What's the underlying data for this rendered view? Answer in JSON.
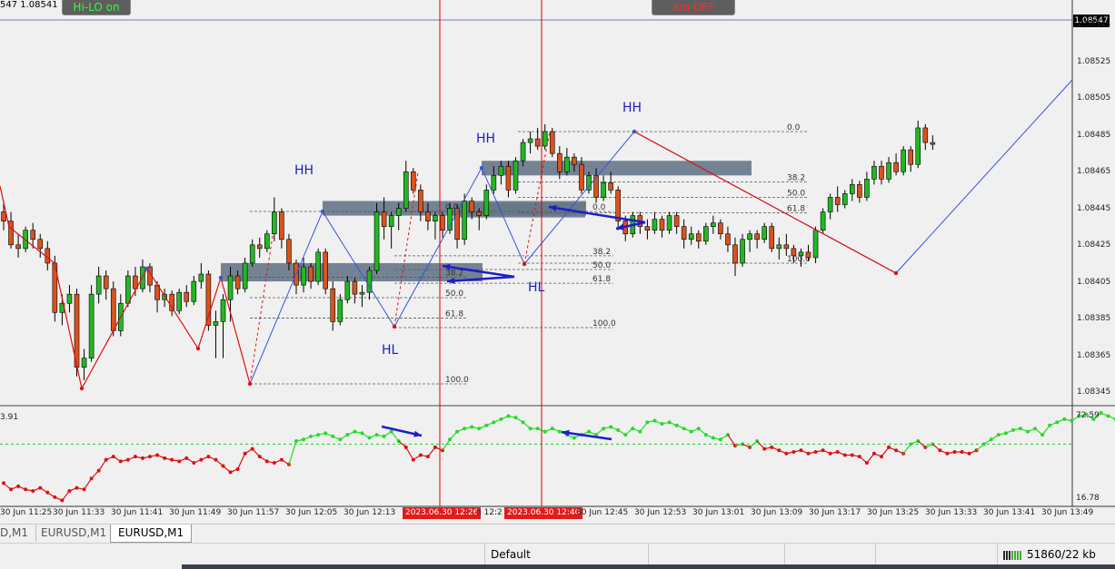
{
  "window": {
    "ohlc_text": "547 1.08541 1.08",
    "current_price": "1.08547",
    "buttons": {
      "hilo": "Hi-LO on",
      "am": "am OFF"
    }
  },
  "price_axis": [
    "1.08545",
    "1.08525",
    "1.08505",
    "1.08485",
    "1.08465",
    "1.08445",
    "1.08425",
    "1.08405",
    "1.08385",
    "1.08365",
    "1.08345"
  ],
  "indicator_axis": {
    "top": "72.59",
    "bottom": "16.78",
    "left_value": "3.91"
  },
  "time_axis": [
    "30 Jun 11:25",
    "30 Jun 11:33",
    "30 Jun 11:41",
    "30 Jun 11:49",
    "30 Jun 11:57",
    "30 Jun 12:05",
    "30 Jun 12:13",
    "2023.06.30 12:26",
    "n 12:2",
    "2023.06.30 12:40",
    "30 Jun 12:45",
    "30 Jun 12:53",
    "30 Jun 13:01",
    "30 Jun 13:09",
    "30 Jun 13:17",
    "30 Jun 13:25",
    "30 Jun 13:33",
    "30 Jun 13:41",
    "30 Jun 13:49"
  ],
  "annotations": {
    "hh1": "HH",
    "hh2": "HH",
    "hh3": "HH",
    "hl1": "HL",
    "hl2": "HL"
  },
  "fibo": [
    "0.0",
    "38.2",
    "50.0",
    "61.8",
    "100.0"
  ],
  "tabs": [
    "D,M1",
    "EURUSD,M1",
    "EURUSD,M1"
  ],
  "status": {
    "profile": "Default",
    "traffic": "51860/22 kb"
  },
  "colors": {
    "bull": "#22b822",
    "bear": "#d9531e",
    "zigzag": "#dd1111",
    "trend": "#3355dd",
    "zone": "#667788",
    "ind_up": "#22dd22",
    "ind_down": "#dd1111",
    "vline": "#dd0000"
  },
  "chart_data": {
    "type": "candlestick",
    "symbol": "EURUSD",
    "timeframe": "M1",
    "ylim": [
      1.08335,
      1.08555
    ],
    "candles": [
      [
        1.0844,
        1.08446,
        1.0843,
        1.08435
      ],
      [
        1.08435,
        1.0844,
        1.0842,
        1.08422
      ],
      [
        1.08422,
        1.08428,
        1.08415,
        1.0842
      ],
      [
        1.0842,
        1.08432,
        1.08418,
        1.0843
      ],
      [
        1.0843,
        1.08434,
        1.0842,
        1.08425
      ],
      [
        1.08425,
        1.08428,
        1.08415,
        1.0842
      ],
      [
        1.0842,
        1.08424,
        1.08408,
        1.08412
      ],
      [
        1.08412,
        1.08416,
        1.0838,
        1.08385
      ],
      [
        1.08385,
        1.08395,
        1.08378,
        1.0839
      ],
      [
        1.0839,
        1.084,
        1.08385,
        1.08395
      ],
      [
        1.08395,
        1.08398,
        1.0835,
        1.08355
      ],
      [
        1.08355,
        1.08365,
        1.08348,
        1.0836
      ],
      [
        1.0836,
        1.084,
        1.08358,
        1.08395
      ],
      [
        1.08395,
        1.0841,
        1.0839,
        1.08405
      ],
      [
        1.08405,
        1.08408,
        1.08392,
        1.08398
      ],
      [
        1.08398,
        1.08402,
        1.08372,
        1.08375
      ],
      [
        1.08375,
        1.08395,
        1.08372,
        1.0839
      ],
      [
        1.0839,
        1.08408,
        1.08388,
        1.08405
      ],
      [
        1.08405,
        1.0841,
        1.08394,
        1.08398
      ],
      [
        1.08398,
        1.08414,
        1.08396,
        1.0841
      ],
      [
        1.0841,
        1.08412,
        1.08396,
        1.084
      ],
      [
        1.084,
        1.08402,
        1.08385,
        1.08392
      ],
      [
        1.08392,
        1.08398,
        1.08388,
        1.08395
      ],
      [
        1.08395,
        1.08397,
        1.08383,
        1.08386
      ],
      [
        1.08386,
        1.08398,
        1.08384,
        1.08396
      ],
      [
        1.08396,
        1.084,
        1.08388,
        1.08391
      ],
      [
        1.08391,
        1.08405,
        1.08389,
        1.08402
      ],
      [
        1.08402,
        1.08412,
        1.08398,
        1.08406
      ],
      [
        1.08406,
        1.08408,
        1.08375,
        1.08378
      ],
      [
        1.08378,
        1.08386,
        1.0836,
        1.0838
      ],
      [
        1.0838,
        1.08395,
        1.0836,
        1.08392
      ],
      [
        1.08392,
        1.0841,
        1.0838,
        1.08405
      ],
      [
        1.08405,
        1.08408,
        1.08395,
        1.08398
      ],
      [
        1.08398,
        1.08415,
        1.08396,
        1.08412
      ],
      [
        1.08412,
        1.08425,
        1.0841,
        1.08422
      ],
      [
        1.08422,
        1.08426,
        1.08415,
        1.0842
      ],
      [
        1.0842,
        1.0843,
        1.08418,
        1.08428
      ],
      [
        1.08428,
        1.08448,
        1.08424,
        1.0844
      ],
      [
        1.0844,
        1.08442,
        1.0842,
        1.08425
      ],
      [
        1.08425,
        1.08428,
        1.08408,
        1.08412
      ],
      [
        1.08412,
        1.08414,
        1.08395,
        1.084
      ],
      [
        1.084,
        1.08415,
        1.08396,
        1.0841
      ],
      [
        1.0841,
        1.08412,
        1.08398,
        1.08402
      ],
      [
        1.08402,
        1.0842,
        1.084,
        1.08418
      ],
      [
        1.08418,
        1.0842,
        1.08395,
        1.08398
      ],
      [
        1.08398,
        1.08402,
        1.08375,
        1.0838
      ],
      [
        1.0838,
        1.08395,
        1.08378,
        1.08392
      ],
      [
        1.08392,
        1.08405,
        1.0839,
        1.08402
      ],
      [
        1.08402,
        1.08404,
        1.0839,
        1.08395
      ],
      [
        1.08395,
        1.084,
        1.08388,
        1.08396
      ],
      [
        1.08396,
        1.0841,
        1.08392,
        1.08408
      ],
      [
        1.08408,
        1.08445,
        1.08406,
        1.0844
      ],
      [
        1.0844,
        1.08448,
        1.08425,
        1.08432
      ],
      [
        1.08432,
        1.0844,
        1.0842,
        1.08438
      ],
      [
        1.08438,
        1.08445,
        1.0843,
        1.08442
      ],
      [
        1.08442,
        1.08468,
        1.0844,
        1.08462
      ],
      [
        1.08462,
        1.08464,
        1.0845,
        1.08452
      ],
      [
        1.08452,
        1.08455,
        1.08435,
        1.0844
      ],
      [
        1.0844,
        1.08445,
        1.0843,
        1.08435
      ],
      [
        1.08435,
        1.0844,
        1.08425,
        1.08438
      ],
      [
        1.08438,
        1.0844,
        1.08426,
        1.0843
      ],
      [
        1.0843,
        1.08445,
        1.08428,
        1.08442
      ],
      [
        1.08442,
        1.08444,
        1.0842,
        1.08425
      ],
      [
        1.08425,
        1.0845,
        1.08422,
        1.08446
      ],
      [
        1.08446,
        1.08448,
        1.08436,
        1.0844
      ],
      [
        1.0844,
        1.08442,
        1.0843,
        1.08438
      ],
      [
        1.08438,
        1.08455,
        1.08436,
        1.08452
      ],
      [
        1.08452,
        1.08465,
        1.0845,
        1.0846
      ],
      [
        1.0846,
        1.08468,
        1.08455,
        1.08465
      ],
      [
        1.08465,
        1.08468,
        1.08448,
        1.08452
      ],
      [
        1.08452,
        1.0847,
        1.0845,
        1.08468
      ],
      [
        1.08468,
        1.0848,
        1.08465,
        1.08478
      ],
      [
        1.08478,
        1.08484,
        1.08472,
        1.0848
      ],
      [
        1.0848,
        1.08486,
        1.08474,
        1.08476
      ],
      [
        1.08476,
        1.08488,
        1.08474,
        1.08484
      ],
      [
        1.08484,
        1.08486,
        1.0847,
        1.08472
      ],
      [
        1.08472,
        1.08476,
        1.08458,
        1.08462
      ],
      [
        1.08462,
        1.08475,
        1.0846,
        1.0847
      ],
      [
        1.0847,
        1.08472,
        1.08462,
        1.08466
      ],
      [
        1.08466,
        1.0847,
        1.0845,
        1.08452
      ],
      [
        1.08452,
        1.08462,
        1.0845,
        1.0846
      ],
      [
        1.0846,
        1.08464,
        1.08445,
        1.08448
      ],
      [
        1.08448,
        1.0846,
        1.08446,
        1.08456
      ],
      [
        1.08456,
        1.08462,
        1.0845,
        1.08452
      ],
      [
        1.08452,
        1.08454,
        1.0843,
        1.08435
      ],
      [
        1.08435,
        1.08438,
        1.08424,
        1.08428
      ],
      [
        1.08428,
        1.0844,
        1.08426,
        1.08438
      ],
      [
        1.08438,
        1.0844,
        1.08428,
        1.08432
      ],
      [
        1.08432,
        1.08436,
        1.08425,
        1.0843
      ],
      [
        1.0843,
        1.0844,
        1.08428,
        1.08436
      ],
      [
        1.08436,
        1.08438,
        1.08426,
        1.0843
      ],
      [
        1.0843,
        1.0844,
        1.08428,
        1.08438
      ],
      [
        1.08438,
        1.0844,
        1.08428,
        1.08432
      ],
      [
        1.08432,
        1.08436,
        1.0842,
        1.08425
      ],
      [
        1.08425,
        1.08432,
        1.08422,
        1.08428
      ],
      [
        1.08428,
        1.0843,
        1.0842,
        1.08424
      ],
      [
        1.08424,
        1.08434,
        1.08422,
        1.08432
      ],
      [
        1.08432,
        1.08438,
        1.08428,
        1.08434
      ],
      [
        1.08434,
        1.08436,
        1.08425,
        1.08428
      ],
      [
        1.08428,
        1.08432,
        1.08418,
        1.08422
      ],
      [
        1.08422,
        1.08426,
        1.08405,
        1.08412
      ],
      [
        1.08412,
        1.08428,
        1.0841,
        1.08425
      ],
      [
        1.08425,
        1.0843,
        1.08418,
        1.08428
      ],
      [
        1.08428,
        1.0843,
        1.0842,
        1.08425
      ],
      [
        1.08425,
        1.08434,
        1.08423,
        1.08432
      ],
      [
        1.08432,
        1.08434,
        1.08418,
        1.0842
      ],
      [
        1.0842,
        1.08426,
        1.08414,
        1.08422
      ],
      [
        1.08422,
        1.08428,
        1.08416,
        1.0842
      ],
      [
        1.0842,
        1.08422,
        1.08412,
        1.08416
      ],
      [
        1.08416,
        1.0842,
        1.0841,
        1.08418
      ],
      [
        1.08418,
        1.08422,
        1.08413,
        1.08415
      ],
      [
        1.08415,
        1.08432,
        1.08412,
        1.0843
      ],
      [
        1.0843,
        1.08442,
        1.08428,
        1.0844
      ],
      [
        1.0844,
        1.0845,
        1.08436,
        1.08448
      ],
      [
        1.08448,
        1.08454,
        1.0844,
        1.08444
      ],
      [
        1.08444,
        1.08452,
        1.08442,
        1.0845
      ],
      [
        1.0845,
        1.08458,
        1.08446,
        1.08455
      ],
      [
        1.08455,
        1.08457,
        1.08445,
        1.08448
      ],
      [
        1.08448,
        1.08462,
        1.08446,
        1.08458
      ],
      [
        1.08458,
        1.08468,
        1.08455,
        1.08465
      ],
      [
        1.08465,
        1.08468,
        1.08455,
        1.08458
      ],
      [
        1.08458,
        1.0847,
        1.08456,
        1.08467
      ],
      [
        1.08467,
        1.08472,
        1.0846,
        1.08462
      ],
      [
        1.08462,
        1.08476,
        1.0846,
        1.08474
      ],
      [
        1.08474,
        1.08476,
        1.08462,
        1.08466
      ],
      [
        1.08466,
        1.0849,
        1.08464,
        1.08486
      ],
      [
        1.08486,
        1.08488,
        1.08474,
        1.08478
      ],
      [
        1.08478,
        1.08482,
        1.08474,
        1.08477
      ]
    ],
    "indicator": {
      "top_label": "72.59",
      "bottom_label": "16.78",
      "values": [
        27,
        23,
        25,
        23,
        22,
        24,
        21,
        18,
        16,
        22,
        24,
        23,
        30,
        35,
        42,
        44,
        41,
        42,
        44,
        43,
        44,
        45,
        43,
        42,
        41,
        43,
        40,
        42,
        44,
        42,
        38,
        34,
        36,
        46,
        49,
        44,
        41,
        40,
        42,
        39,
        54,
        55,
        57,
        58,
        59,
        57,
        55,
        58,
        60,
        59,
        56,
        58,
        57,
        60,
        54,
        50,
        42,
        45,
        44,
        50,
        48,
        55,
        60,
        62,
        63,
        62,
        64,
        66,
        68,
        70,
        69,
        66,
        62,
        62,
        60,
        62,
        60,
        58,
        56,
        58,
        60,
        58,
        62,
        63,
        61,
        58,
        62,
        60,
        66,
        67,
        65,
        66,
        64,
        62,
        60,
        62,
        58,
        56,
        55,
        58,
        51,
        52,
        50,
        54,
        49,
        50,
        48,
        46,
        47,
        48,
        46,
        47,
        48,
        46,
        47,
        45,
        45,
        44,
        40,
        46,
        44,
        50,
        48,
        46,
        52,
        54,
        50,
        52,
        48,
        46,
        47,
        47,
        46,
        48,
        52,
        55,
        58,
        59,
        61,
        62,
        60,
        62,
        58,
        64,
        66,
        68,
        67,
        70,
        71,
        68,
        72,
        70,
        68,
        68
      ],
      "level": 52
    }
  }
}
